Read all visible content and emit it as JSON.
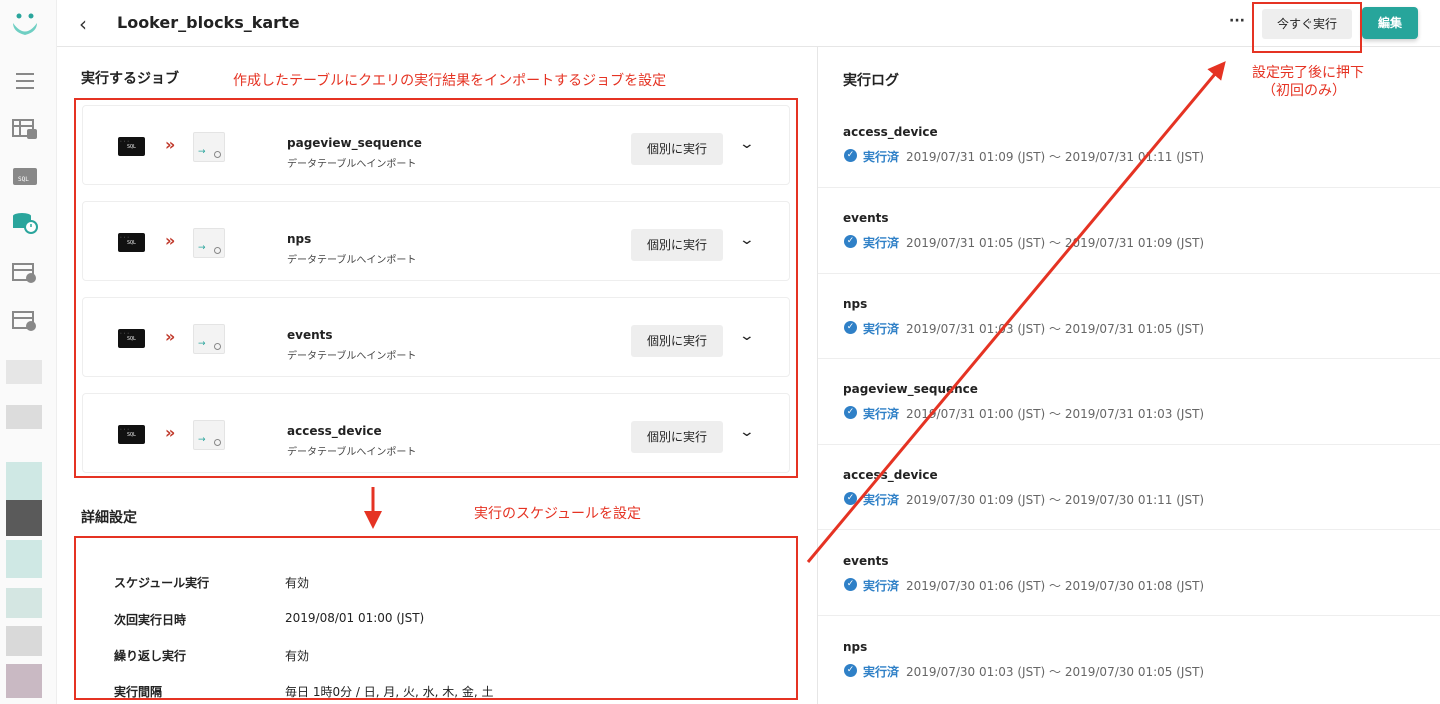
{
  "header": {
    "title": "Looker_blocks_karte",
    "more_label": "···",
    "run_now_label": "今すぐ実行",
    "edit_label": "編集"
  },
  "jobs": {
    "title": "実行するジョブ",
    "items": [
      {
        "sql": "SQL",
        "arrow": "»",
        "name": "pageview_sequence",
        "desc": "データテーブルへインポート",
        "run": "個別に実行"
      },
      {
        "sql": "SQL",
        "arrow": "»",
        "name": "nps",
        "desc": "データテーブルへインポート",
        "run": "個別に実行"
      },
      {
        "sql": "SQL",
        "arrow": "»",
        "name": "events",
        "desc": "データテーブルへインポート",
        "run": "個別に実行"
      },
      {
        "sql": "SQL",
        "arrow": "»",
        "name": "access_device",
        "desc": "データテーブルへインポート",
        "run": "個別に実行"
      }
    ]
  },
  "details": {
    "title": "詳細設定",
    "rows": [
      {
        "label": "スケジュール実行",
        "value": "有効"
      },
      {
        "label": "次回実行日時",
        "value": "2019/08/01 01:00 (JST)"
      },
      {
        "label": "繰り返し実行",
        "value": "有効"
      },
      {
        "label": "実行間隔",
        "value": "毎日 1時0分 / 日, 月, 火, 水, 木, 金, 土"
      }
    ]
  },
  "log": {
    "title": "実行ログ",
    "items": [
      {
        "name": "access_device",
        "status": "実行済",
        "time": "2019/07/31 01:09 (JST) 〜 2019/07/31 01:11 (JST)"
      },
      {
        "name": "events",
        "status": "実行済",
        "time": "2019/07/31 01:05 (JST) 〜 2019/07/31 01:09 (JST)"
      },
      {
        "name": "nps",
        "status": "実行済",
        "time": "2019/07/31 01:03 (JST) 〜 2019/07/31 01:05 (JST)"
      },
      {
        "name": "pageview_sequence",
        "status": "実行済",
        "time": "2019/07/31 01:00 (JST) 〜 2019/07/31 01:03 (JST)"
      },
      {
        "name": "access_device",
        "status": "実行済",
        "time": "2019/07/30 01:09 (JST) 〜 2019/07/30 01:11 (JST)"
      },
      {
        "name": "events",
        "status": "実行済",
        "time": "2019/07/30 01:06 (JST) 〜 2019/07/30 01:08 (JST)"
      },
      {
        "name": "nps",
        "status": "実行済",
        "time": "2019/07/30 01:03 (JST) 〜 2019/07/30 01:05 (JST)"
      }
    ]
  },
  "annotations": {
    "jobs_note": "作成したテーブルにクエリの実行結果をインポートするジョブを設定",
    "schedule_note": "実行のスケジュールを設定",
    "run_note_line1": "設定完了後に押下",
    "run_note_line2": "（初回のみ）"
  },
  "colors": {
    "accent": "#27a59b",
    "annotation": "#e53323",
    "status": "#2f80c7"
  }
}
